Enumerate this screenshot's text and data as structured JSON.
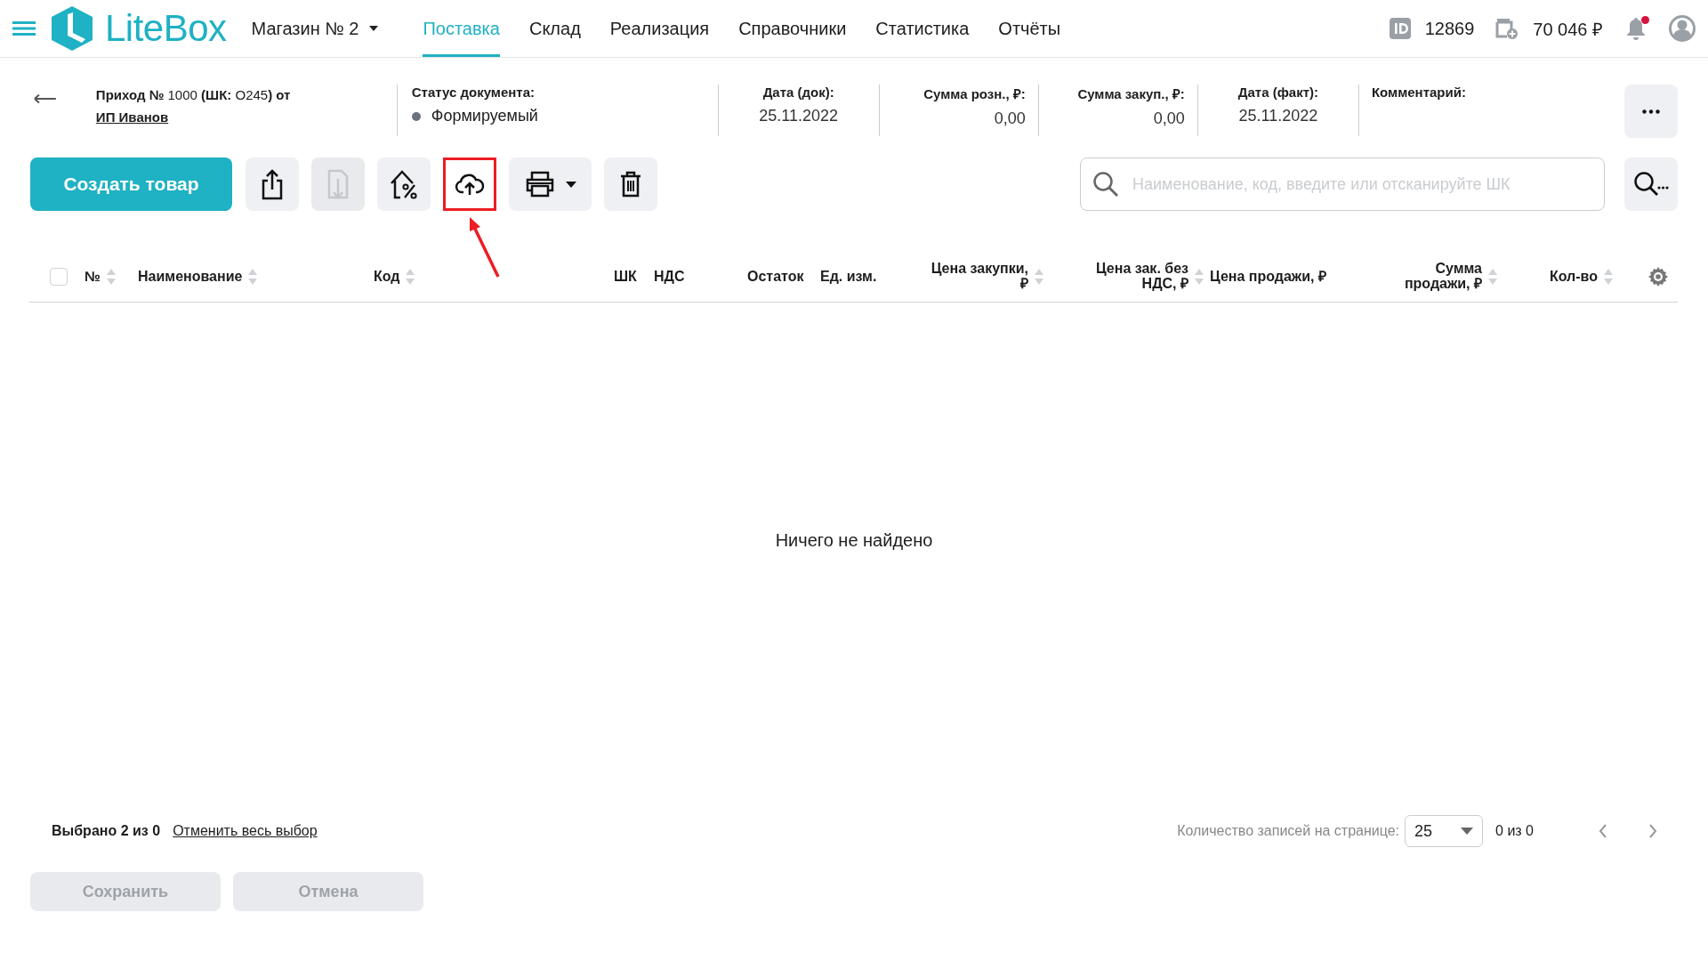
{
  "header": {
    "logo_text": "LiteBox",
    "store": "Магазин № 2",
    "nav": [
      {
        "label": "Поставка",
        "selected": true
      },
      {
        "label": "Склад",
        "selected": false
      },
      {
        "label": "Реализация",
        "selected": false
      },
      {
        "label": "Справочники",
        "selected": false
      },
      {
        "label": "Статистика",
        "selected": false
      },
      {
        "label": "Отчёты",
        "selected": false
      }
    ],
    "user_id": "12869",
    "balance": "70 046 ₽",
    "has_notification": true
  },
  "document": {
    "title": "**Приход №** 1000 **(ШК:** О245**) от**",
    "supplier": "ИП Иванов",
    "status_label": "Статус документа:",
    "status": "Формируемый",
    "fields": [
      {
        "kind": "date",
        "label": "Дата (док):",
        "value": "25.11.2022"
      },
      {
        "kind": "sum",
        "label": "Сумма розн., ₽:",
        "value": "0,00"
      },
      {
        "kind": "sum",
        "label": "Сумма закуп., ₽:",
        "value": "0,00"
      },
      {
        "kind": "date",
        "label": "Дата (факт):",
        "value": "25.11.2022"
      },
      {
        "kind": "comment",
        "label": "Комментарий:"
      }
    ]
  },
  "toolbar": {
    "create_button": "Создать товар",
    "tools": [
      {
        "kind": "export",
        "disabled": false,
        "highlighted": false
      },
      {
        "kind": "import",
        "disabled": true,
        "highlighted": false
      },
      {
        "kind": "markup",
        "disabled": false,
        "highlighted": false
      },
      {
        "kind": "upload",
        "disabled": false,
        "highlighted": true
      },
      {
        "kind": "print",
        "disabled": false,
        "highlighted": false
      },
      {
        "kind": "delete",
        "disabled": false,
        "highlighted": false
      }
    ],
    "search": {
      "placeholder": "Наименование, код, введите или отсканируйте ШК"
    }
  },
  "table": {
    "select_all_checked": false,
    "columns": [
      {
        "label": "№",
        "sortable": true
      },
      {
        "label": "Наименование",
        "sortable": true
      },
      {
        "label": "Код",
        "sortable": true
      },
      {
        "label": "ШК",
        "sortable": false
      },
      {
        "label": "НДС",
        "sortable": false
      },
      {
        "label": "Остаток",
        "sortable": false
      },
      {
        "label": "Ед. изм.",
        "sortable": false
      },
      {
        "label": "Цена закупки, ₽",
        "sortable": true
      },
      {
        "label": "Цена зак. без НДС, ₽",
        "sortable": true
      },
      {
        "label": "Цена продажи, ₽",
        "sortable": false
      },
      {
        "label": "Сумма продажи, ₽",
        "sortable": true
      },
      {
        "label": "Кол-во",
        "sortable": true
      }
    ],
    "empty_text": "Ничего не найдено"
  },
  "footer": {
    "selection": "Выбрано 2 из 0",
    "clear_link": "Отменить весь выбор",
    "page_size_label": "Количество записей на странице:",
    "page_size": "25",
    "range": "0 из 0",
    "buttons": [
      {
        "label": "Сохранить",
        "disabled": true
      },
      {
        "label": "Отмена",
        "disabled": true
      }
    ]
  }
}
